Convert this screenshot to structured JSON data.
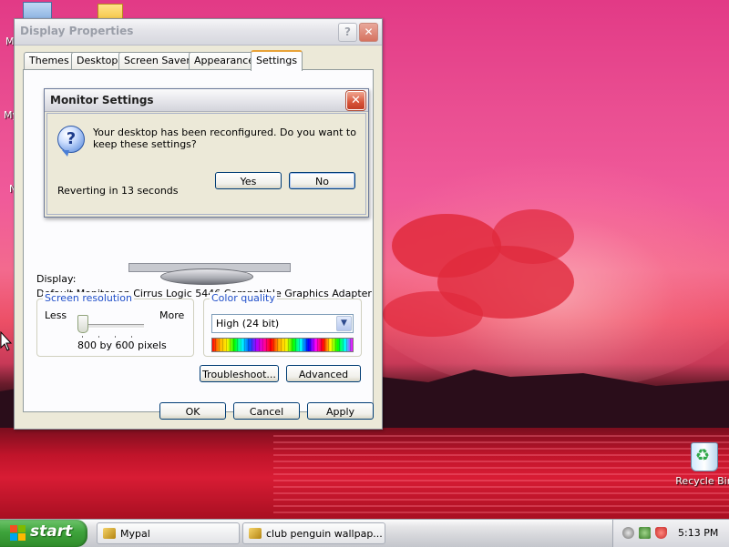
{
  "desktop": {
    "recycle_bin_label": "Recycle Bin",
    "partial_icon_labels": [
      "M",
      "My",
      "N"
    ]
  },
  "display_properties": {
    "title": "Display Properties",
    "help_button": "?",
    "close_button": "✕",
    "tabs": [
      {
        "label": "Themes"
      },
      {
        "label": "Desktop"
      },
      {
        "label": "Screen Saver"
      },
      {
        "label": "Appearance"
      },
      {
        "label": "Settings",
        "active": true
      }
    ],
    "display_label": "Display:",
    "display_value": "Default Monitor on Cirrus Logic 5446 Compatible Graphics Adapter",
    "screen_resolution": {
      "title": "Screen resolution",
      "less_label": "Less",
      "more_label": "More",
      "value": "800 by 600 pixels",
      "slider_position": 0
    },
    "color_quality": {
      "title": "Color quality",
      "selected": "High (24 bit)",
      "dropdown_icon": "chevron-down-icon"
    },
    "troubleshoot_button": "Troubleshoot...",
    "advanced_button": "Advanced",
    "ok_button": "OK",
    "cancel_button": "Cancel",
    "apply_button": "Apply"
  },
  "monitor_settings": {
    "title": "Monitor Settings",
    "close_button": "✕",
    "icon": "question-icon",
    "message": "Your desktop has been reconfigured.  Do you want to keep these settings?",
    "revert_text": "Reverting in 13 seconds",
    "yes_button": "Yes",
    "no_button": "No"
  },
  "taskbar": {
    "start_label": "start",
    "tasks": [
      {
        "label": "Mypal"
      },
      {
        "label": "club penguin wallpap..."
      }
    ],
    "clock": "5:13 PM"
  },
  "colors": {
    "xp_orange_tab": "#e8a33a",
    "group_title_blue": "#1f4ec9",
    "start_green": "#3ea33b"
  }
}
